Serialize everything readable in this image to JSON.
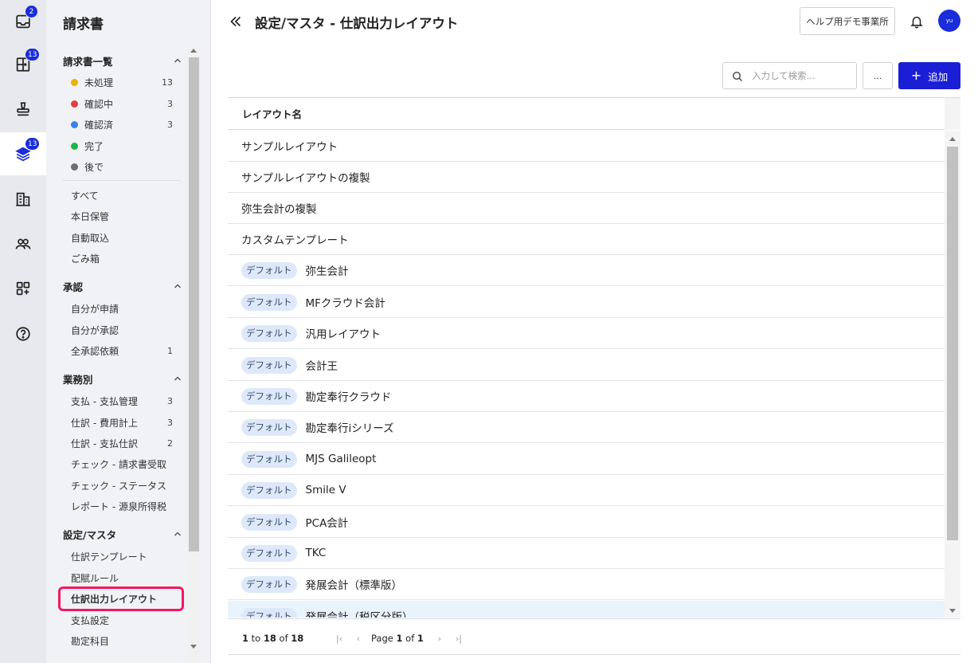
{
  "rail": {
    "items": [
      {
        "icon": "inbox-icon",
        "badge": "2"
      },
      {
        "icon": "door-icon",
        "badge": "13"
      },
      {
        "icon": "stamp-icon",
        "badge": ""
      },
      {
        "icon": "layers-icon",
        "badge": "13",
        "active": true
      },
      {
        "icon": "building-icon",
        "badge": ""
      },
      {
        "icon": "users-icon",
        "badge": ""
      },
      {
        "icon": "apps-add-icon",
        "badge": ""
      },
      {
        "icon": "help-icon",
        "badge": ""
      }
    ]
  },
  "nav": {
    "title": "請求書",
    "sections": [
      {
        "title": "請求書一覧",
        "items": [
          {
            "label": "未処理",
            "count": "13",
            "dot": "#e8b400"
          },
          {
            "label": "確認中",
            "count": "3",
            "dot": "#e04040"
          },
          {
            "label": "確認済",
            "count": "3",
            "dot": "#3a82e8"
          },
          {
            "label": "完了",
            "count": "",
            "dot": "#22b44a"
          },
          {
            "label": "後で",
            "count": "",
            "dot": "#6a6e78"
          }
        ],
        "extra": [
          {
            "label": "すべて"
          },
          {
            "label": "本日保管"
          },
          {
            "label": "自動取込"
          },
          {
            "label": "ごみ箱"
          }
        ]
      },
      {
        "title": "承認",
        "items": [
          {
            "label": "自分が申請",
            "count": ""
          },
          {
            "label": "自分が承認",
            "count": ""
          },
          {
            "label": "全承認依頼",
            "count": "1"
          }
        ]
      },
      {
        "title": "業務別",
        "items": [
          {
            "label": "支払 - 支払管理",
            "count": "3"
          },
          {
            "label": "仕訳 - 費用計上",
            "count": "3"
          },
          {
            "label": "仕訳 - 支払仕訳",
            "count": "2"
          },
          {
            "label": "チェック - 請求書受取",
            "count": ""
          },
          {
            "label": "チェック - ステータス",
            "count": ""
          },
          {
            "label": "レポート - 源泉所得税",
            "count": ""
          }
        ]
      },
      {
        "title": "設定/マスタ",
        "items": [
          {
            "label": "仕訳テンプレート",
            "count": ""
          },
          {
            "label": "配賦ルール",
            "count": ""
          },
          {
            "label": "仕訳出力レイアウト",
            "count": "",
            "selected": true
          },
          {
            "label": "支払設定",
            "count": ""
          },
          {
            "label": "勘定科目",
            "count": ""
          }
        ]
      }
    ]
  },
  "header": {
    "title": "設定/マスタ - 仕訳出力レイアウト",
    "help_label": "ヘルプ用デモ事業所",
    "avatar_initials": "yu"
  },
  "toolbar": {
    "search_placeholder": "入力して検索...",
    "more_label": "...",
    "add_label": "追加"
  },
  "table": {
    "column_header": "レイアウト名",
    "rows": [
      {
        "tag": "",
        "name": "サンプルレイアウト"
      },
      {
        "tag": "",
        "name": "サンプルレイアウトの複製"
      },
      {
        "tag": "",
        "name": "弥生会計の複製"
      },
      {
        "tag": "",
        "name": "カスタムテンプレート"
      },
      {
        "tag": "デフォルト",
        "name": "弥生会計"
      },
      {
        "tag": "デフォルト",
        "name": "MFクラウド会計"
      },
      {
        "tag": "デフォルト",
        "name": "汎用レイアウト"
      },
      {
        "tag": "デフォルト",
        "name": "会計王"
      },
      {
        "tag": "デフォルト",
        "name": "勘定奉行クラウド"
      },
      {
        "tag": "デフォルト",
        "name": "勘定奉行iシリーズ"
      },
      {
        "tag": "デフォルト",
        "name": "MJS Galileopt"
      },
      {
        "tag": "デフォルト",
        "name": "Smile V"
      },
      {
        "tag": "デフォルト",
        "name": "PCA会計"
      },
      {
        "tag": "デフォルト",
        "name": "TKC"
      },
      {
        "tag": "デフォルト",
        "name": "発展会計（標準版）"
      },
      {
        "tag": "デフォルト",
        "name": "発展会計（税区分版）",
        "highlighted": true
      }
    ],
    "footer": {
      "range_start": "1",
      "range_to": "to",
      "range_end": "18",
      "range_of": "of",
      "total": "18",
      "page_word": "Page",
      "page_current": "1",
      "page_of": "of",
      "page_total": "1"
    }
  }
}
